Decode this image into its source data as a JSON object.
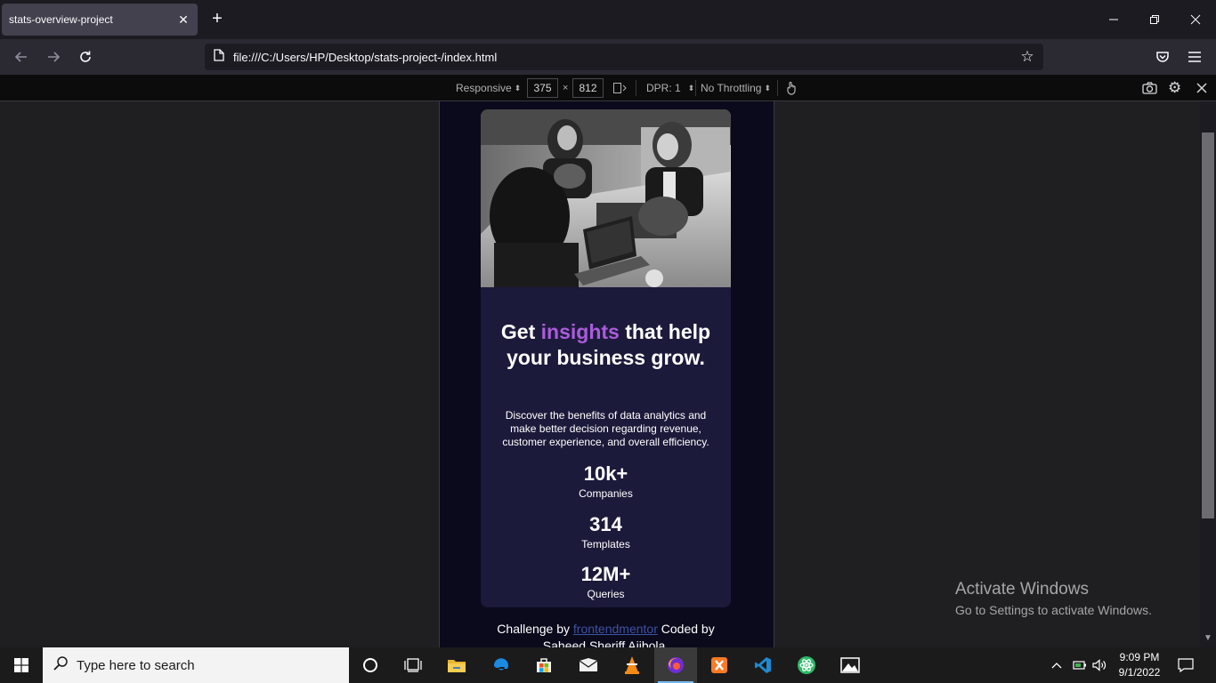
{
  "browser": {
    "tab_title": "stats-overview-project",
    "url": "file:///C:/Users/HP/Desktop/stats-project-/index.html"
  },
  "rdm": {
    "device": "Responsive",
    "width": "375",
    "times": "×",
    "height": "812",
    "dpr": "DPR: 1",
    "throttling": "No Throttling"
  },
  "page": {
    "title_before": "Get ",
    "title_accent": "insights",
    "title_after": " that help your business grow.",
    "description": "Discover the benefits of data analytics and make better decision regarding revenue, customer experience, and overall efficiency.",
    "stats": [
      {
        "value": "10k+",
        "label": "Companies"
      },
      {
        "value": "314",
        "label": "Templates"
      },
      {
        "value": "12M+",
        "label": "Queries"
      }
    ],
    "attribution_prefix": "Challenge by ",
    "attribution_link": "frontendmentor",
    "attribution_suffix": " Coded by Saheed Sheriff Ajibola."
  },
  "watermark": {
    "line1": "Activate Windows",
    "line2": "Go to Settings to activate Windows."
  },
  "taskbar": {
    "search_placeholder": "Type here to search",
    "time": "9:09 PM",
    "date": "9/1/2022"
  },
  "colors": {
    "accent": "#aa5cdb",
    "card": "#1c1a3a",
    "page_bg": "#0b0a1c"
  }
}
